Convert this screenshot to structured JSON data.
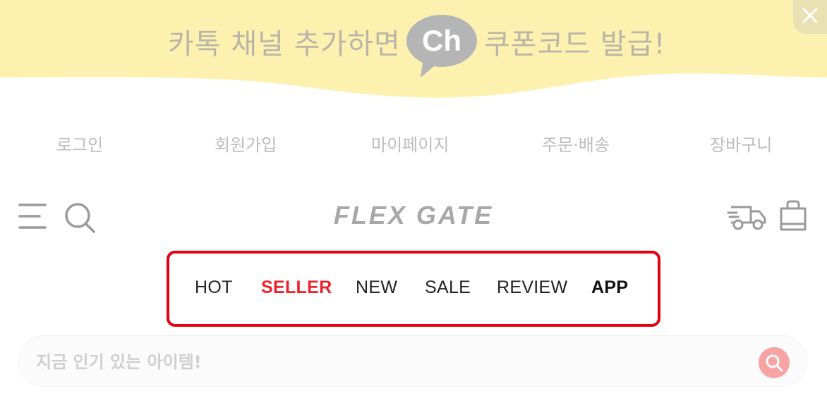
{
  "banner": {
    "text_left": "카톡 채널 추가하면",
    "channel_badge": "Ch",
    "text_right": "쿠폰코드 발급!",
    "close_icon": "close-icon",
    "colors": {
      "background": "#fdf1b0",
      "text": "#b9b5a8",
      "badge": "#b5b5b5"
    }
  },
  "top_links": [
    "로그인",
    "회원가입",
    "마이페이지",
    "주문·배송",
    "장바구니"
  ],
  "header": {
    "logo_text": "FLEX GATE",
    "icons": [
      "menu-icon",
      "search-icon",
      "delivery-truck-icon",
      "shopping-bag-icon"
    ]
  },
  "categories": [
    {
      "label": "HOT",
      "style": "normal"
    },
    {
      "label": "SELLER",
      "style": "red"
    },
    {
      "label": "NEW",
      "style": "normal"
    },
    {
      "label": "SALE",
      "style": "normal"
    },
    {
      "label": "REVIEW",
      "style": "normal"
    },
    {
      "label": "APP",
      "style": "bold"
    }
  ],
  "search": {
    "placeholder": "지금 인기 있는 아이템!",
    "value": "",
    "button_icon": "search-icon",
    "button_color": "#f8a3a3"
  },
  "highlight_color": "#e3000f"
}
